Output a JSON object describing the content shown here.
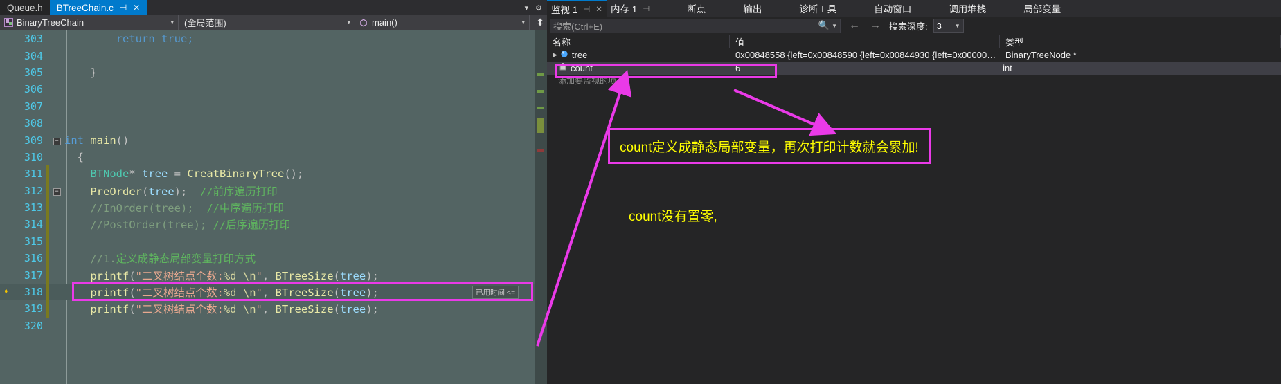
{
  "editor": {
    "tabs": [
      {
        "label": "Queue.h",
        "active": false
      },
      {
        "label": "BTreeChain.c",
        "active": true
      }
    ],
    "tab_pin_icon": "pin-icon",
    "tab_close_icon": "close-icon",
    "navbar": {
      "project": "BinaryTreeChain",
      "scope": "(全局范围)",
      "member": "main()",
      "project_icon": "cpp-project-icon",
      "member_icon": "method-icon"
    },
    "elapsed_badge": "已用时间 <=",
    "lines": [
      {
        "num": "303",
        "parts": [
          {
            "t": "        return true;",
            "c": "c-key"
          }
        ],
        "indentdim": true
      },
      {
        "num": "304",
        "parts": []
      },
      {
        "num": "305",
        "parts": [
          {
            "t": "    }",
            "c": "c-punc"
          }
        ]
      },
      {
        "num": "306",
        "parts": []
      },
      {
        "num": "307",
        "parts": []
      },
      {
        "num": "308",
        "parts": []
      },
      {
        "num": "309",
        "fold": "-",
        "parts": [
          {
            "t": "int",
            "c": "c-key"
          },
          {
            "t": " ",
            "c": "c-plain"
          },
          {
            "t": "main",
            "c": "c-fn"
          },
          {
            "t": "()",
            "c": "c-punc"
          }
        ]
      },
      {
        "num": "310",
        "parts": [
          {
            "t": "  {",
            "c": "c-punc"
          }
        ]
      },
      {
        "num": "311",
        "mod": true,
        "parts": [
          {
            "t": "    ",
            "c": "c-plain"
          },
          {
            "t": "BTNode",
            "c": "c-type"
          },
          {
            "t": "* ",
            "c": "c-punc"
          },
          {
            "t": "tree",
            "c": "c-var"
          },
          {
            "t": " = ",
            "c": "c-punc"
          },
          {
            "t": "CreatBinaryTree",
            "c": "c-fn"
          },
          {
            "t": "();",
            "c": "c-punc"
          }
        ]
      },
      {
        "num": "312",
        "fold": "-",
        "mod": true,
        "parts": [
          {
            "t": "    ",
            "c": "c-plain"
          },
          {
            "t": "PreOrder",
            "c": "c-fn"
          },
          {
            "t": "(",
            "c": "c-punc"
          },
          {
            "t": "tree",
            "c": "c-var"
          },
          {
            "t": ");  ",
            "c": "c-punc"
          },
          {
            "t": "//前序遍历打印",
            "c": "c-cmt"
          }
        ]
      },
      {
        "num": "313",
        "mod": true,
        "parts": [
          {
            "t": "    //InOrder(tree);  ",
            "c": "c-cmt-d"
          },
          {
            "t": "//中序遍历打印",
            "c": "c-cmt"
          }
        ]
      },
      {
        "num": "314",
        "mod": true,
        "parts": [
          {
            "t": "    //PostOrder(tree); ",
            "c": "c-cmt-d"
          },
          {
            "t": "//后序遍历打印",
            "c": "c-cmt"
          }
        ]
      },
      {
        "num": "315",
        "mod": true,
        "parts": []
      },
      {
        "num": "316",
        "mod": true,
        "parts": [
          {
            "t": "    //1.",
            "c": "c-cmt-d"
          },
          {
            "t": "定义成静态局部变量打印方式",
            "c": "c-cmt"
          }
        ]
      },
      {
        "num": "317",
        "mod": true,
        "parts": [
          {
            "t": "    ",
            "c": "c-plain"
          },
          {
            "t": "printf",
            "c": "c-fn"
          },
          {
            "t": "(",
            "c": "c-punc"
          },
          {
            "t": "\"二叉树结点个数:",
            "c": "c-str"
          },
          {
            "t": "%d",
            "c": "c-esc"
          },
          {
            "t": " ",
            "c": "c-str"
          },
          {
            "t": "\\n",
            "c": "c-esc"
          },
          {
            "t": "\"",
            "c": "c-str"
          },
          {
            "t": ", ",
            "c": "c-punc"
          },
          {
            "t": "BTreeSize",
            "c": "c-fn"
          },
          {
            "t": "(",
            "c": "c-punc"
          },
          {
            "t": "tree",
            "c": "c-var"
          },
          {
            "t": ");",
            "c": "c-punc"
          }
        ]
      },
      {
        "num": "318",
        "current": true,
        "mod": true,
        "parts": [
          {
            "t": "    ",
            "c": "c-plain"
          },
          {
            "t": "printf",
            "c": "c-fn"
          },
          {
            "t": "(",
            "c": "c-punc"
          },
          {
            "t": "\"二叉树结点个数:",
            "c": "c-str"
          },
          {
            "t": "%d",
            "c": "c-esc"
          },
          {
            "t": " ",
            "c": "c-str"
          },
          {
            "t": "\\n",
            "c": "c-esc"
          },
          {
            "t": "\"",
            "c": "c-str"
          },
          {
            "t": ", ",
            "c": "c-punc"
          },
          {
            "t": "BTreeSize",
            "c": "c-fn"
          },
          {
            "t": "(",
            "c": "c-punc"
          },
          {
            "t": "tree",
            "c": "c-var"
          },
          {
            "t": ");",
            "c": "c-punc"
          }
        ]
      },
      {
        "num": "319",
        "mod": true,
        "parts": [
          {
            "t": "    ",
            "c": "c-plain"
          },
          {
            "t": "printf",
            "c": "c-fn"
          },
          {
            "t": "(",
            "c": "c-punc"
          },
          {
            "t": "\"二叉树结点个数:",
            "c": "c-str"
          },
          {
            "t": "%d",
            "c": "c-esc"
          },
          {
            "t": " ",
            "c": "c-str"
          },
          {
            "t": "\\n",
            "c": "c-esc"
          },
          {
            "t": "\"",
            "c": "c-str"
          },
          {
            "t": ", ",
            "c": "c-punc"
          },
          {
            "t": "BTreeSize",
            "c": "c-fn"
          },
          {
            "t": "(",
            "c": "c-punc"
          },
          {
            "t": "tree",
            "c": "c-var"
          },
          {
            "t": ");",
            "c": "c-punc"
          }
        ]
      },
      {
        "num": "320",
        "parts": []
      }
    ],
    "current_line_arrow": "current-statement-arrow-icon"
  },
  "watch": {
    "tabs": [
      {
        "label": "监视 1",
        "active": true,
        "pinnable": true,
        "closable": true
      },
      {
        "label": "内存 1",
        "active": false,
        "pinnable": true,
        "closable": false
      },
      {
        "label": "断点",
        "active": false
      },
      {
        "label": "输出",
        "active": false
      },
      {
        "label": "诊断工具",
        "active": false
      },
      {
        "label": "自动窗口",
        "active": false
      },
      {
        "label": "调用堆栈",
        "active": false
      },
      {
        "label": "局部变量",
        "active": false
      }
    ],
    "search": {
      "placeholder": "搜索(Ctrl+E)",
      "value": "",
      "magnifier_icon": "search-icon",
      "dropdown_icon": "chevron-down-icon",
      "prev_icon": "arrow-left-icon",
      "next_icon": "arrow-right-icon",
      "depth_label": "搜索深度:",
      "depth_value": "3"
    },
    "columns": [
      "名称",
      "值",
      "类型"
    ],
    "rows": [
      {
        "name": "tree",
        "value": "0x00848558 {left=0x00848590 {left=0x00844930 {left=0x0000000...",
        "type": "BinaryTreeNode *",
        "expander": "▶",
        "icon": "variable-icon",
        "highlighted": false,
        "refresh": false
      },
      {
        "name": "count",
        "value": "6",
        "type": "int",
        "expander": "",
        "icon": "static-field-icon",
        "highlighted": true,
        "refresh": true,
        "refresh_icon": "refresh-icon"
      }
    ],
    "add_watch_placeholder": "添加要监视的项"
  },
  "annotations": {
    "box_text": "count定义成静态局部变量，再次打印计数就会累加!",
    "note_text": "count没有置零,",
    "accent_color": "#ea3ae8",
    "text_color": "#ffff00"
  }
}
